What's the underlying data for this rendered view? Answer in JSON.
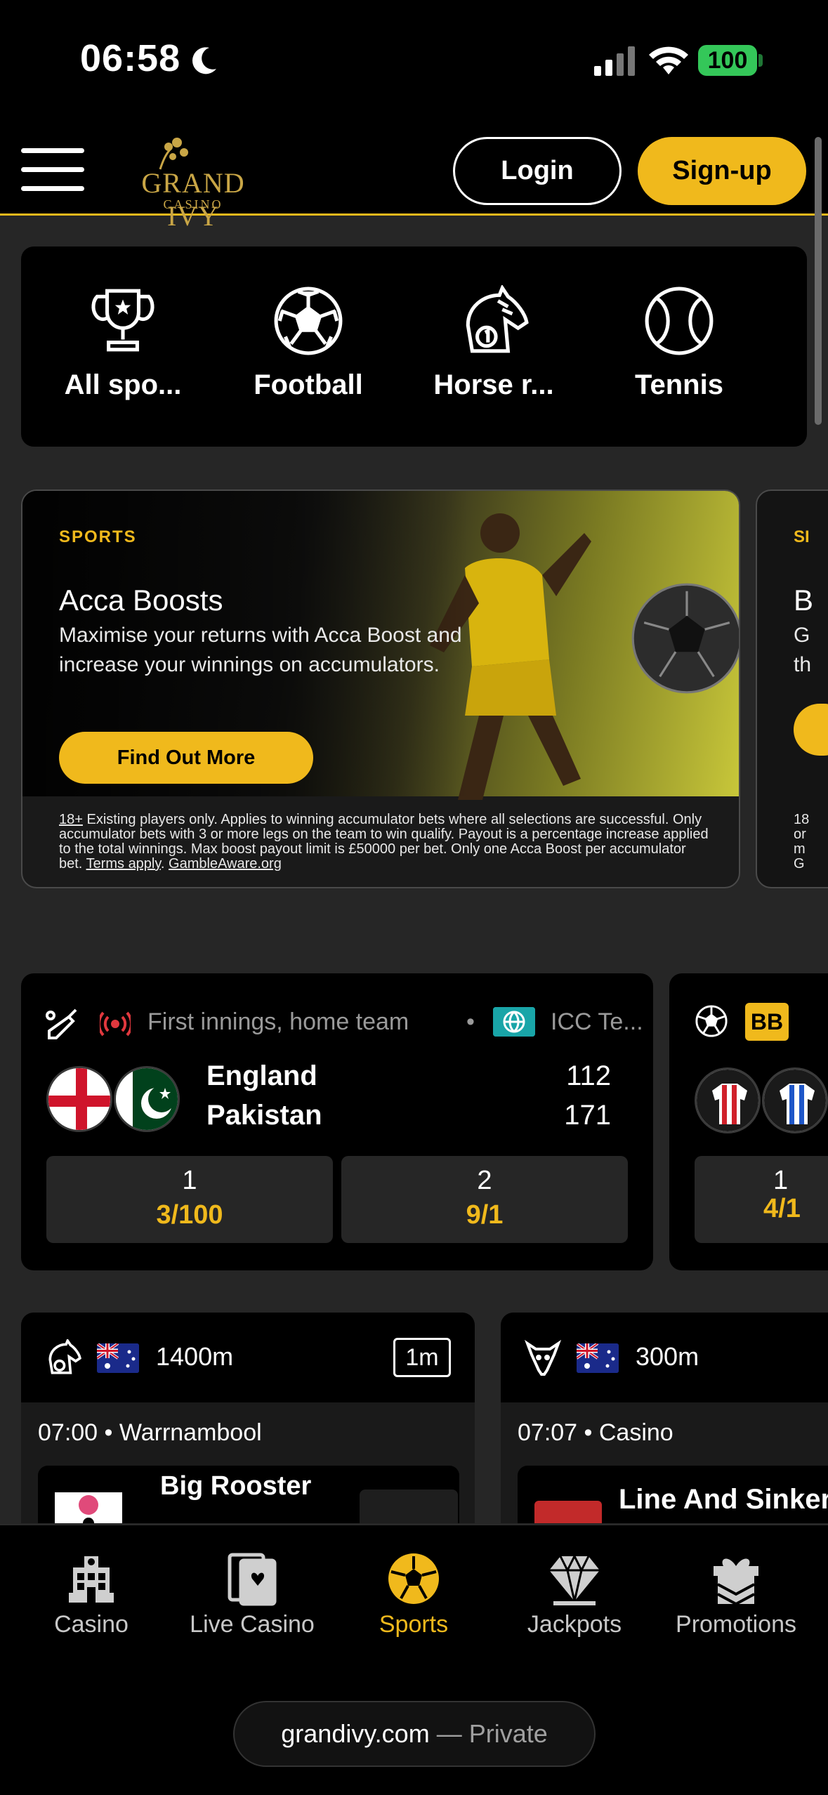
{
  "status_bar": {
    "time": "06:58",
    "battery": "100"
  },
  "header": {
    "logo_text": "GRAND IVY",
    "logo_sub": "CASINO",
    "login_label": "Login",
    "signup_label": "Sign-up",
    "accent_color": "#f0b91c"
  },
  "categories": [
    {
      "label": "All spo...",
      "icon": "trophy-icon"
    },
    {
      "label": "Football",
      "icon": "football-icon"
    },
    {
      "label": "Horse r...",
      "icon": "horse-icon"
    },
    {
      "label": "Tennis",
      "icon": "tennis-ball-icon"
    }
  ],
  "promo": {
    "tag": "SPORTS",
    "title": "Acca Boosts",
    "description": "Maximise your returns with Acca Boost and increase your winnings on accumulators.",
    "button_label": "Find Out More",
    "terms_age": "18+",
    "terms_text": " Existing players only. Applies to winning accumulator bets where all selections are successful. Only accumulator bets with 3 or more legs on the team to win qualify. Payout is a percentage increase applied to the total winnings. Max boost payout limit is £50000 per bet. Only one Acca Boost per accumulator bet. ",
    "terms_link": "Terms apply",
    "gamble_link": "GambleAware.org",
    "next_tag": "SI",
    "next_title": "B",
    "next_desc": "G\nth",
    "next_terms": "18\nor\nm\nG"
  },
  "match": {
    "status": "First innings, home team",
    "competition": "ICC Te...",
    "teams": [
      {
        "name": "England",
        "score": "112"
      },
      {
        "name": "Pakistan",
        "score": "171"
      }
    ],
    "odds": [
      {
        "label": "1",
        "value": "3/100"
      },
      {
        "label": "2",
        "value": "9/1"
      }
    ]
  },
  "match2": {
    "badge": "BB",
    "odd_label": "1",
    "odd_value": "4/1"
  },
  "races": [
    {
      "distance": "1400m",
      "countdown": "1m",
      "when": "07:00 • Warrnambool",
      "runner": "Big Rooster"
    },
    {
      "distance": "300m",
      "when": "07:07 • Casino",
      "runner": "Line And Sinker"
    }
  ],
  "tabs": [
    {
      "label": "Casino",
      "icon": "casino-building-icon"
    },
    {
      "label": "Live Casino",
      "icon": "cards-icon"
    },
    {
      "label": "Sports",
      "icon": "sports-ball-icon",
      "active": true
    },
    {
      "label": "Jackpots",
      "icon": "diamond-icon"
    },
    {
      "label": "Promotions",
      "icon": "gift-icon"
    }
  ],
  "browser": {
    "host": "grandivy.com",
    "mode": " — Private"
  }
}
